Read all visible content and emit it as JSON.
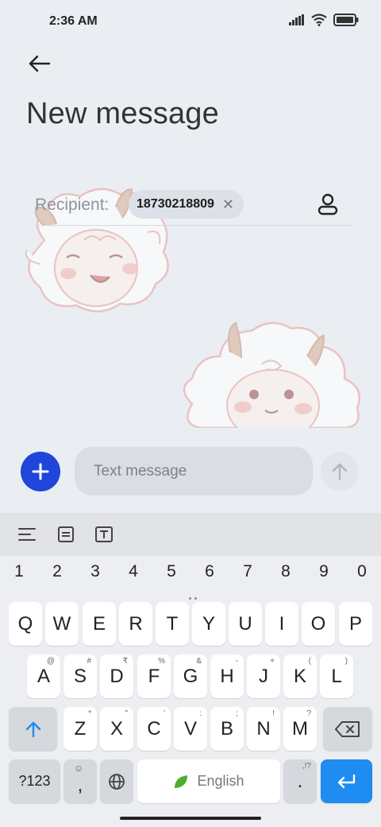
{
  "status": {
    "time": "2:36 AM"
  },
  "header": {
    "title": "New message"
  },
  "recipient": {
    "label": "Recipient:",
    "chip": "18730218809"
  },
  "compose": {
    "placeholder": "Text message"
  },
  "keyboard": {
    "numbers": [
      "1",
      "2",
      "3",
      "4",
      "5",
      "6",
      "7",
      "8",
      "9",
      "0"
    ],
    "row1": [
      "Q",
      "W",
      "E",
      "R",
      "T",
      "Y",
      "U",
      "I",
      "O",
      "P"
    ],
    "row2": [
      {
        "k": "A",
        "h": "@"
      },
      {
        "k": "S",
        "h": "#"
      },
      {
        "k": "D",
        "h": "₹"
      },
      {
        "k": "F",
        "h": "%"
      },
      {
        "k": "G",
        "h": "&"
      },
      {
        "k": "H",
        "h": "-"
      },
      {
        "k": "J",
        "h": "+"
      },
      {
        "k": "K",
        "h": "("
      },
      {
        "k": "L",
        "h": ")"
      }
    ],
    "row3": [
      {
        "k": "Z",
        "h": "*"
      },
      {
        "k": "X",
        "h": "\""
      },
      {
        "k": "C",
        "h": "'"
      },
      {
        "k": "V",
        "h": ":"
      },
      {
        "k": "B",
        "h": ";"
      },
      {
        "k": "N",
        "h": "!"
      },
      {
        "k": "M",
        "h": "?"
      }
    ],
    "symbols_label": "?123",
    "comma": ",",
    "space_label": "English",
    "period": ".",
    "period_hint": ",!?"
  },
  "colors": {
    "accent": "#1f46d8",
    "enter": "#1e8cf0",
    "background": "#eaeef3"
  }
}
